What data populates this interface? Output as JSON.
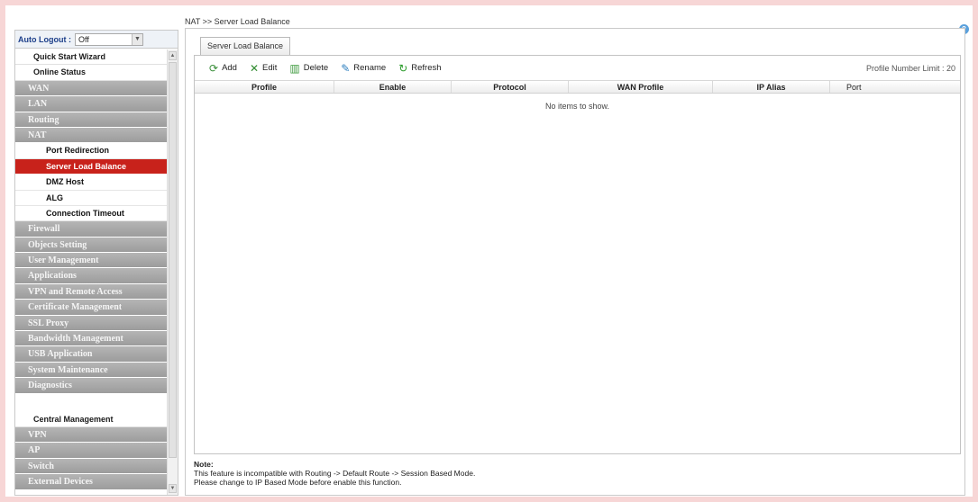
{
  "breadcrumb": "NAT >> Server Load Balance",
  "sidebar": {
    "auto_logout_label": "Auto Logout :",
    "auto_logout_value": "Off",
    "items": [
      {
        "label": "Quick Start Wizard"
      },
      {
        "label": "Online Status"
      },
      {
        "label": "WAN"
      },
      {
        "label": "LAN"
      },
      {
        "label": "Routing"
      },
      {
        "label": "NAT"
      },
      {
        "label": "Port Redirection"
      },
      {
        "label": "Server Load Balance"
      },
      {
        "label": "DMZ Host"
      },
      {
        "label": "ALG"
      },
      {
        "label": "Connection Timeout"
      },
      {
        "label": "Firewall"
      },
      {
        "label": "Objects Setting"
      },
      {
        "label": "User Management"
      },
      {
        "label": "Applications"
      },
      {
        "label": "VPN and Remote Access"
      },
      {
        "label": "Certificate Management"
      },
      {
        "label": "SSL Proxy"
      },
      {
        "label": "Bandwidth Management"
      },
      {
        "label": "USB Application"
      },
      {
        "label": "System Maintenance"
      },
      {
        "label": "Diagnostics"
      },
      {
        "label": "Central Management"
      },
      {
        "label": "VPN"
      },
      {
        "label": "AP"
      },
      {
        "label": "Switch"
      },
      {
        "label": "External Devices"
      }
    ]
  },
  "tab": {
    "label": "Server Load Balance"
  },
  "toolbar": {
    "add": "Add",
    "edit": "Edit",
    "delete": "Delete",
    "rename": "Rename",
    "refresh": "Refresh",
    "profile_limit": "Profile Number Limit : 20"
  },
  "grid": {
    "columns": [
      "Profile",
      "Enable",
      "Protocol",
      "WAN Profile",
      "IP Alias",
      "Port"
    ],
    "empty": "No items to show."
  },
  "note": {
    "title": "Note:",
    "line1": "This feature is incompatible with Routing -> Default Route -> Session Based Mode.",
    "line2": "Please change to IP Based Mode before enable this function."
  },
  "colors": {
    "active": "#c8221b",
    "menu_gray": "#a8a8a8",
    "frame": "#f7d6d6"
  }
}
